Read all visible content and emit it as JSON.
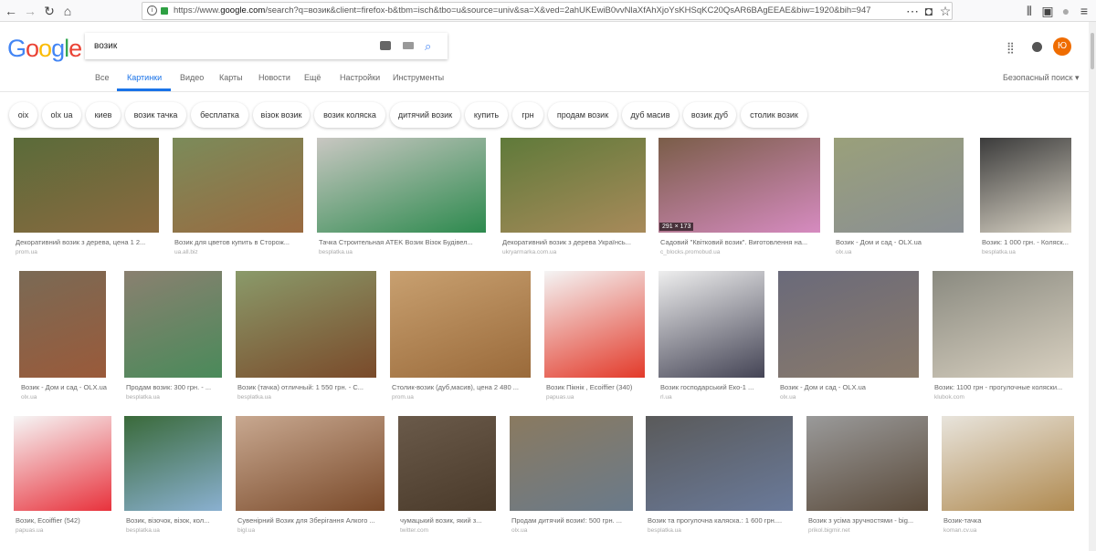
{
  "browser": {
    "url_prefix": "https://www.",
    "url_domain": "google.com",
    "url_rest": "/search?q=возик&client=firefox-b&tbm=isch&tbo=u&source=univ&sa=X&ved=2ahUKEwiB0vvNlaXfAhXjoYsKHSqKC20QsAR6BAgEEAE&biw=1920&bih=947"
  },
  "logo": "Google",
  "search": {
    "value": "возик"
  },
  "account_initial": "Ю",
  "tabs": [
    "Все",
    "Картинки",
    "Видео",
    "Карты",
    "Новости",
    "Ещё",
    "Настройки",
    "Инструменты"
  ],
  "safe_search": "Безопасный поиск",
  "chips": [
    "oix",
    "olx ua",
    "киев",
    "возик тачка",
    "бесплатка",
    "візок возик",
    "возик коляска",
    "дитячий возик",
    "купить",
    "грн",
    "продам возик",
    "дуб масив",
    "возик дуб",
    "столик возик"
  ],
  "hover_dimensions": "291 × 173",
  "results": [
    {
      "title": "Декоративний возик з дерева, цена 1 2...",
      "source": "prom.ua"
    },
    {
      "title": "Возик для цветов купить в Сторож...",
      "source": "ua.all.biz"
    },
    {
      "title": "Тачка Строительная ATEK Возик Візок Будівел...",
      "source": "besplatka.ua"
    },
    {
      "title": "Декоративний возик з дерева Українсь...",
      "source": "ukryarmarka.com.ua"
    },
    {
      "title": "Садовий \"Квітковий возик\". Виготовлення на...",
      "source": "c_blocks.promobud.ua"
    },
    {
      "title": "Возик - Дом и сад - OLX.ua",
      "source": "olx.ua"
    },
    {
      "title": "Возик: 1 000 грн. - Коляск...",
      "source": "besplatka.ua"
    },
    {
      "title": "Возик - Дом и сад - OLX.ua",
      "source": "olx.ua"
    },
    {
      "title": "Продам возик: 300 грн. - ...",
      "source": "besplatka.ua"
    },
    {
      "title": "Возик (тачка) отличный: 1 550 грн. - С...",
      "source": "besplatka.ua"
    },
    {
      "title": "Столик-возик (дуб,масив), цена 2 480 ...",
      "source": "prom.ua"
    },
    {
      "title": "Возик Пікнік , Ecoiffier (340)",
      "source": "papuas.ua"
    },
    {
      "title": "Возик господарський Еко-1 ...",
      "source": "rl.ua"
    },
    {
      "title": "Возик - Дом и сад - OLX.ua",
      "source": "olx.ua"
    },
    {
      "title": "Возик: 1100 грн - прогулочные коляски...",
      "source": "klubok.com"
    },
    {
      "title": "Возик, Ecoiffier (542)",
      "source": "papuas.ua"
    },
    {
      "title": "Возик, візочок, візок, кол...",
      "source": "besplatka.ua"
    },
    {
      "title": "Сувенірний Возик для Зберігання Алкого ...",
      "source": "bigl.ua"
    },
    {
      "title": "чумацький возик, який з...",
      "source": "twitter.com"
    },
    {
      "title": "Продам дитячий возик!: 500 грн. ...",
      "source": "olx.ua"
    },
    {
      "title": "Возик та прогулочна каляска.: 1 600 грн....",
      "source": "besplatka.ua"
    },
    {
      "title": "Возик з усіма зручностями - big...",
      "source": "prikol.bigmir.net"
    },
    {
      "title": "Возик-тачка",
      "source": "koman.cv.ua"
    }
  ]
}
